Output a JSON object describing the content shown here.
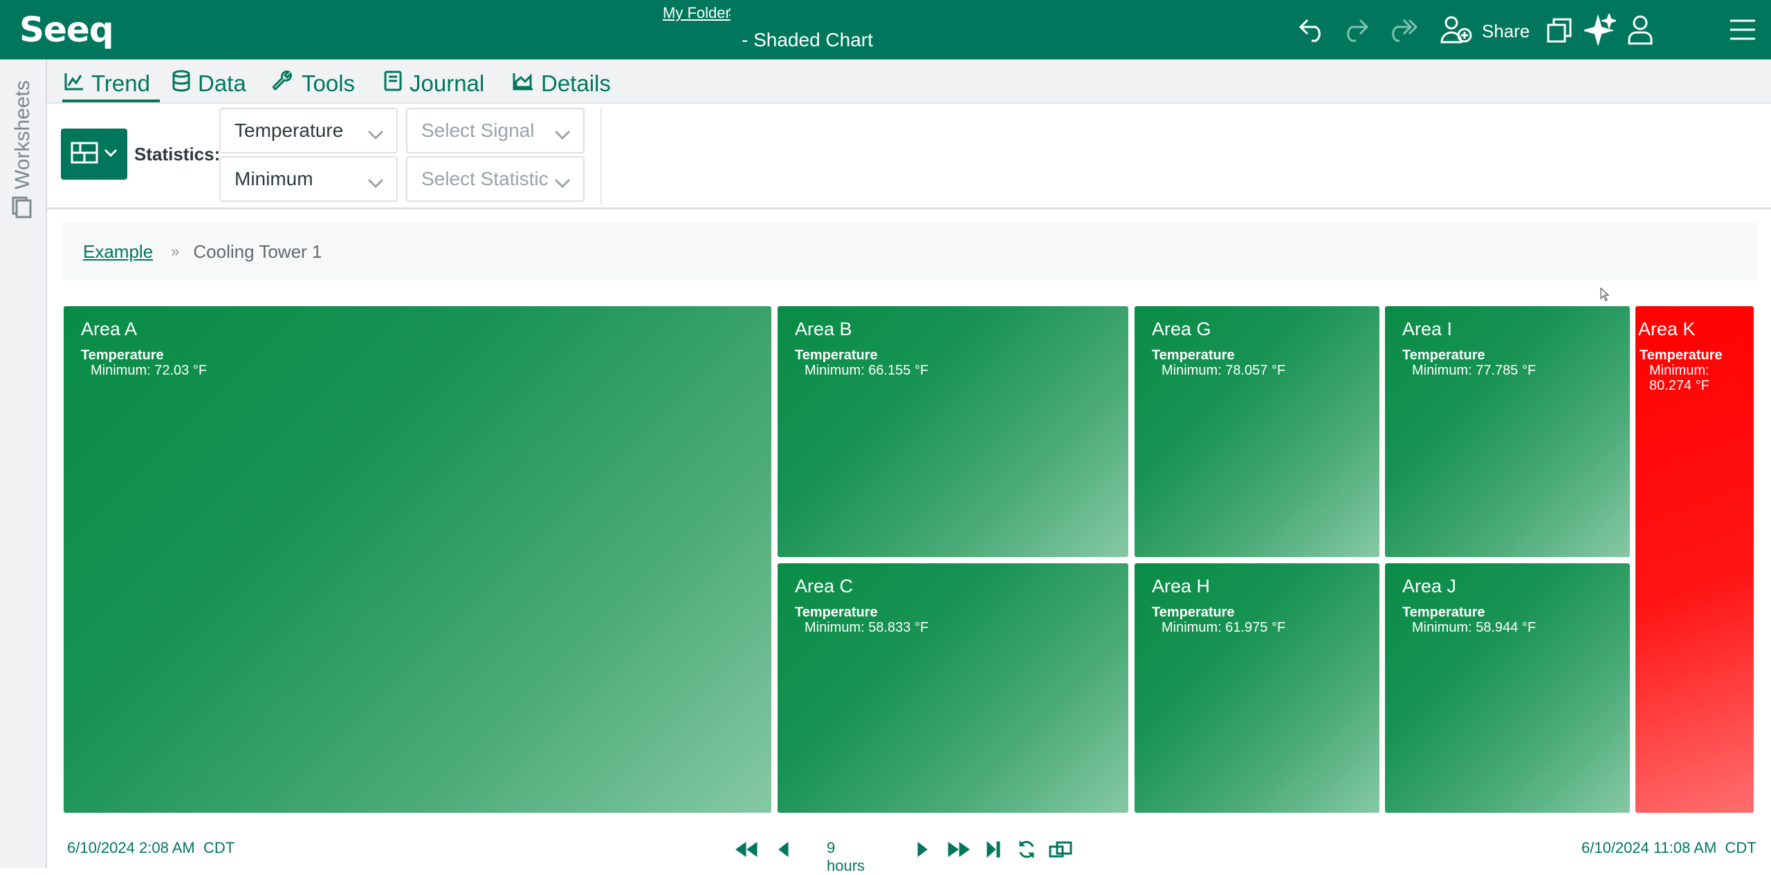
{
  "app": {
    "logo": "Seeq",
    "folder_link": "My Folder",
    "folder_separator": ":",
    "title": "- Shaded Chart"
  },
  "header_actions": {
    "share_label": "Share",
    "icons": [
      "undo-icon",
      "redo-icon",
      "redo-all-icon",
      "add-user-icon",
      "window-icon",
      "ai-sparkle-icon",
      "user-icon",
      "hamburger-menu-icon"
    ]
  },
  "sidebar": {
    "label": "Worksheets",
    "icon": "worksheets-icon"
  },
  "tabs": [
    {
      "label": "Trend",
      "icon": "line-chart-icon",
      "active": true
    },
    {
      "label": "Data",
      "icon": "database-icon",
      "active": false
    },
    {
      "label": "Tools",
      "icon": "wrench-icon",
      "active": false
    },
    {
      "label": "Journal",
      "icon": "journal-icon",
      "active": false
    },
    {
      "label": "Details",
      "icon": "area-chart-icon",
      "active": false
    }
  ],
  "toolbar": {
    "statistics_label": "Statistics:",
    "signal_1": "Temperature",
    "signal_2_placeholder": "Select Signal",
    "statistic_1": "Minimum",
    "statistic_2_placeholder": "Select Statistic"
  },
  "breadcrumb": {
    "link": "Example",
    "separator": "»",
    "current": "Cooling Tower 1"
  },
  "treemap": {
    "colors": {
      "green": "#0a8c45",
      "red": "#ff0000"
    },
    "tiles": [
      {
        "name": "Area A",
        "signal": "Temperature",
        "stat": "Minimum: 72.03 °F",
        "value": 72.03,
        "color": "green"
      },
      {
        "name": "Area B",
        "signal": "Temperature",
        "stat": "Minimum: 66.155 °F",
        "value": 66.155,
        "color": "green"
      },
      {
        "name": "Area C",
        "signal": "Temperature",
        "stat": "Minimum: 58.833 °F",
        "value": 58.833,
        "color": "green"
      },
      {
        "name": "Area G",
        "signal": "Temperature",
        "stat": "Minimum: 78.057 °F",
        "value": 78.057,
        "color": "green"
      },
      {
        "name": "Area H",
        "signal": "Temperature",
        "stat": "Minimum: 61.975 °F",
        "value": 61.975,
        "color": "green"
      },
      {
        "name": "Area I",
        "signal": "Temperature",
        "stat": "Minimum: 77.785 °F",
        "value": 77.785,
        "color": "green"
      },
      {
        "name": "Area J",
        "signal": "Temperature",
        "stat": "Minimum: 58.944 °F",
        "value": 58.944,
        "color": "green"
      },
      {
        "name": "Area K",
        "signal": "Temperature",
        "stat": "Minimum: 80.274 °F",
        "value": 80.274,
        "color": "red"
      }
    ]
  },
  "footer": {
    "start": "6/10/2024 2:08 AM",
    "start_tz": "CDT",
    "duration": "9 hours",
    "end": "6/10/2024 11:08 AM",
    "end_tz": "CDT"
  }
}
